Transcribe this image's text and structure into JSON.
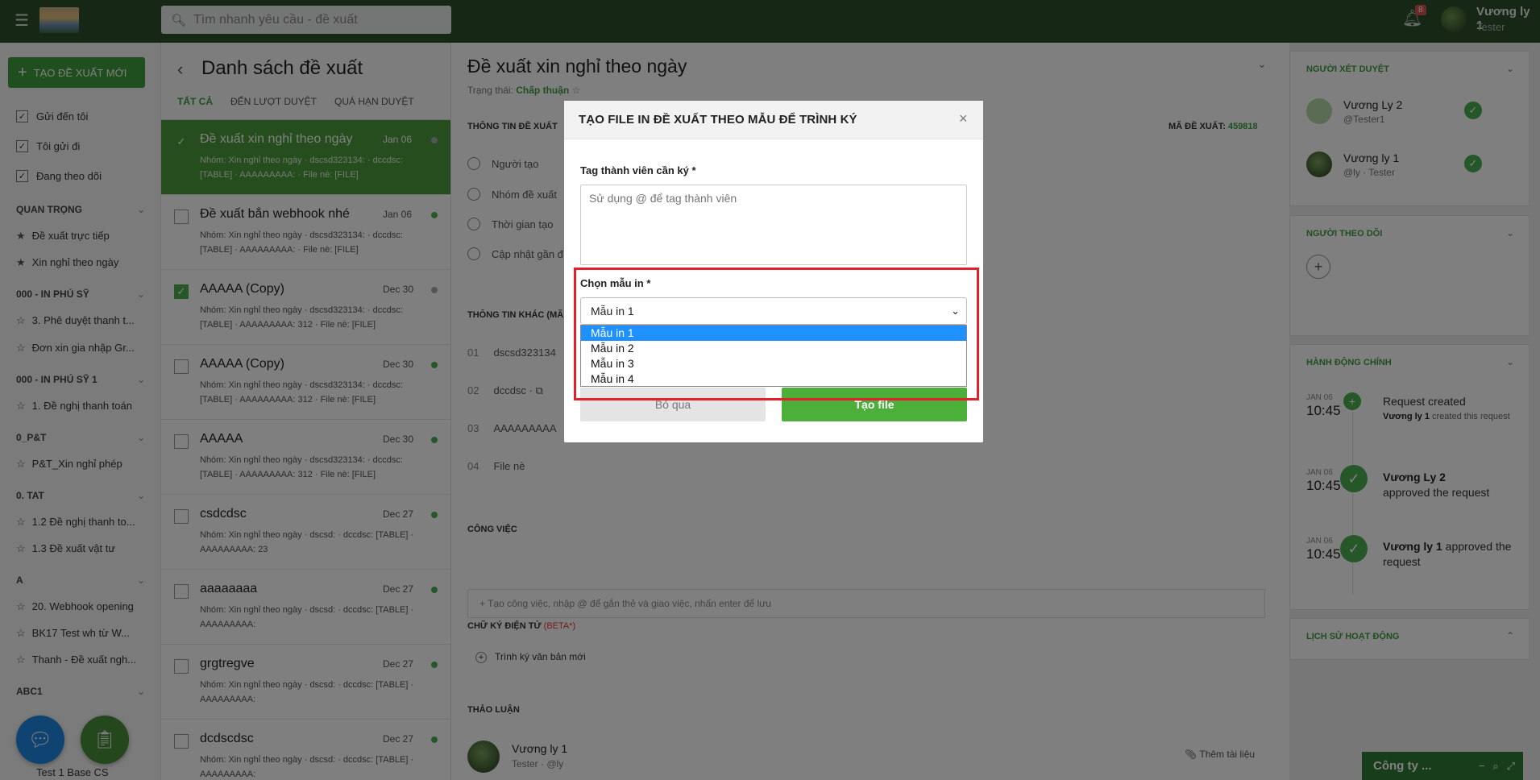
{
  "topbar": {
    "search_placeholder": "Tìm nhanh yêu cầu - đề xuất",
    "notification_count": "8",
    "user_name": "Vương ly 1",
    "user_role": "Tester"
  },
  "sidebar": {
    "new_button": "TẠO ĐỀ XUẤT MỚI",
    "filters": [
      "Gửi đến tôi",
      "Tôi gửi đi",
      "Đang theo dõi"
    ],
    "sections": [
      {
        "title": "QUAN TRỌNG",
        "items": [
          "Đề xuất trực tiếp",
          "Xin nghỉ theo ngày"
        ]
      },
      {
        "title": "000 - IN PHÚ SỸ",
        "items": [
          "3. Phê duyệt thanh t...",
          "Đơn xin gia nhập Gr..."
        ]
      },
      {
        "title": "000 - IN PHÚ SỸ 1",
        "items": [
          "1. Đề nghị thanh toán"
        ]
      },
      {
        "title": "0_P&T",
        "items": [
          "P&T_Xin nghỉ phép"
        ]
      },
      {
        "title": "0. TAT",
        "items": [
          "1.2 Đề nghị thanh to...",
          "1.3 Đề xuất vật tư"
        ]
      },
      {
        "title": "A",
        "items": [
          "20. Webhook opening",
          "BK17 Test wh từ W...",
          "Thanh - Đề xuất ngh..."
        ]
      },
      {
        "title": "ABC1",
        "items": [
          "Test 1 Base CS"
        ]
      }
    ]
  },
  "list": {
    "title": "Danh sách đề xuất",
    "tabs": [
      "TẤT CẢ",
      "ĐẾN LƯỢT DUYỆT",
      "QUÁ HẠN DUYỆT"
    ],
    "items": [
      {
        "title": "Đề xuất xin nghỉ theo ngày",
        "date": "Jan 06",
        "desc": "Nhóm: Xin nghỉ theo ngày · dscsd323134: · dccdsc: [TABLE] · AAAAAAAAA: · File nè: [FILE]"
      },
      {
        "title": "Đề xuất bắn webhook nhé",
        "date": "Jan 06",
        "desc": "Nhóm: Xin nghỉ theo ngày · dscsd323134: · dccdsc: [TABLE] · AAAAAAAAA: · File nè: [FILE]"
      },
      {
        "title": "AAAAA (Copy)",
        "date": "Dec 30",
        "desc": "Nhóm: Xin nghỉ theo ngày · dscsd323134: · dccdsc: [TABLE] · AAAAAAAAA: 312 · File nè: [FILE]"
      },
      {
        "title": "AAAAA (Copy)",
        "date": "Dec 30",
        "desc": "Nhóm: Xin nghỉ theo ngày · dscsd323134: · dccdsc: [TABLE] · AAAAAAAAA: 312 · File nè: [FILE]"
      },
      {
        "title": "AAAAA",
        "date": "Dec 30",
        "desc": "Nhóm: Xin nghỉ theo ngày · dscsd323134: · dccdsc: [TABLE] · AAAAAAAAA: 312 · File nè: [FILE]"
      },
      {
        "title": "csdcdsc",
        "date": "Dec 27",
        "desc": "Nhóm: Xin nghỉ theo ngày · dscsd: · dccdsc: [TABLE] · AAAAAAAAA: 23"
      },
      {
        "title": "aaaaaaaa",
        "date": "Dec 27",
        "desc": "Nhóm: Xin nghỉ theo ngày · dscsd: · dccdsc: [TABLE] · AAAAAAAAA:"
      },
      {
        "title": "grgtregve",
        "date": "Dec 27",
        "desc": "Nhóm: Xin nghỉ theo ngày · dscsd: · dccdsc: [TABLE] · AAAAAAAAA:"
      },
      {
        "title": "dcdscdsc",
        "date": "Dec 27",
        "desc": "Nhóm: Xin nghỉ theo ngày · dscsd: · dccdsc: [TABLE] · AAAAAAAAA:"
      }
    ]
  },
  "main": {
    "title": "Đề xuất xin nghỉ theo ngày",
    "status_label": "Trạng thái:",
    "status_value": "Chấp thuận",
    "info_header": "THÔNG TIN ĐỀ XUẤT",
    "code_label": "MÃ ĐỀ XUẤT:",
    "code_value": "459818",
    "info_rows": [
      "Người tạo",
      "Nhóm đề xuất",
      "Thời gian tạo",
      "Cập nhật gần đ"
    ],
    "other_header": "THÔNG TIN KHÁC (MÃ",
    "other_rows": [
      {
        "num": "01",
        "label": "dscsd323134"
      },
      {
        "num": "02",
        "label": "dccdsc · ⧉"
      },
      {
        "num": "03",
        "label": "AAAAAAAAA"
      },
      {
        "num": "04",
        "label": "File nè"
      }
    ],
    "task_header": "CÔNG VIỆC",
    "task_placeholder": "+  Tạo công việc, nhập @ để gắn thẻ và giao việc, nhấn enter để lưu",
    "sign_header": "CHỮ KÝ ĐIỆN TỬ",
    "sign_beta": "(BETA*)",
    "sign_new": "Trình ký văn bản mới",
    "discussion_header": "THẢO LUẬN",
    "discussion_user": "Vương ly 1",
    "discussion_sub": "Tester · @ly",
    "attach_label": "Thêm tài liệu"
  },
  "right": {
    "approvers_header": "NGƯỜI XÉT DUYỆT",
    "approvers": [
      {
        "name": "Vương Ly 2",
        "sub": "@Tester1"
      },
      {
        "name": "Vương ly 1",
        "sub": "@ly · Tester"
      }
    ],
    "followers_header": "NGƯỜI THEO DÕI",
    "actions_header": "HÀNH ĐỘNG CHÍNH",
    "timeline": [
      {
        "date": "JAN 06",
        "time": "10:45",
        "title": "Request created",
        "actor": "Vương ly 1",
        "sub": "created this request"
      },
      {
        "date": "JAN 06",
        "time": "10:45",
        "actor": "Vương Ly 2",
        "text": "approved the request"
      },
      {
        "date": "JAN 06",
        "time": "10:45",
        "actor": "Vương ly 1",
        "text": "approved the request"
      }
    ],
    "history_header": "LỊCH SỬ HOẠT ĐỘNG"
  },
  "mini_chat": {
    "label": "Công ty ..."
  },
  "modal": {
    "title": "TẠO FILE IN ĐỀ XUẤT THEO MẪU ĐỂ TRÌNH KÝ",
    "tag_label": "Tag thành viên cần ký *",
    "tag_placeholder": "Sử dụng @ để tag thành viên",
    "template_label": "Chọn mẫu in *",
    "template_selected": "Mẫu in 1",
    "template_options": [
      "Mẫu in 1",
      "Mẫu in 2",
      "Mẫu in 3",
      "Mẫu in 4"
    ],
    "cancel_label": "Bỏ qua",
    "create_label": "Tạo file"
  }
}
